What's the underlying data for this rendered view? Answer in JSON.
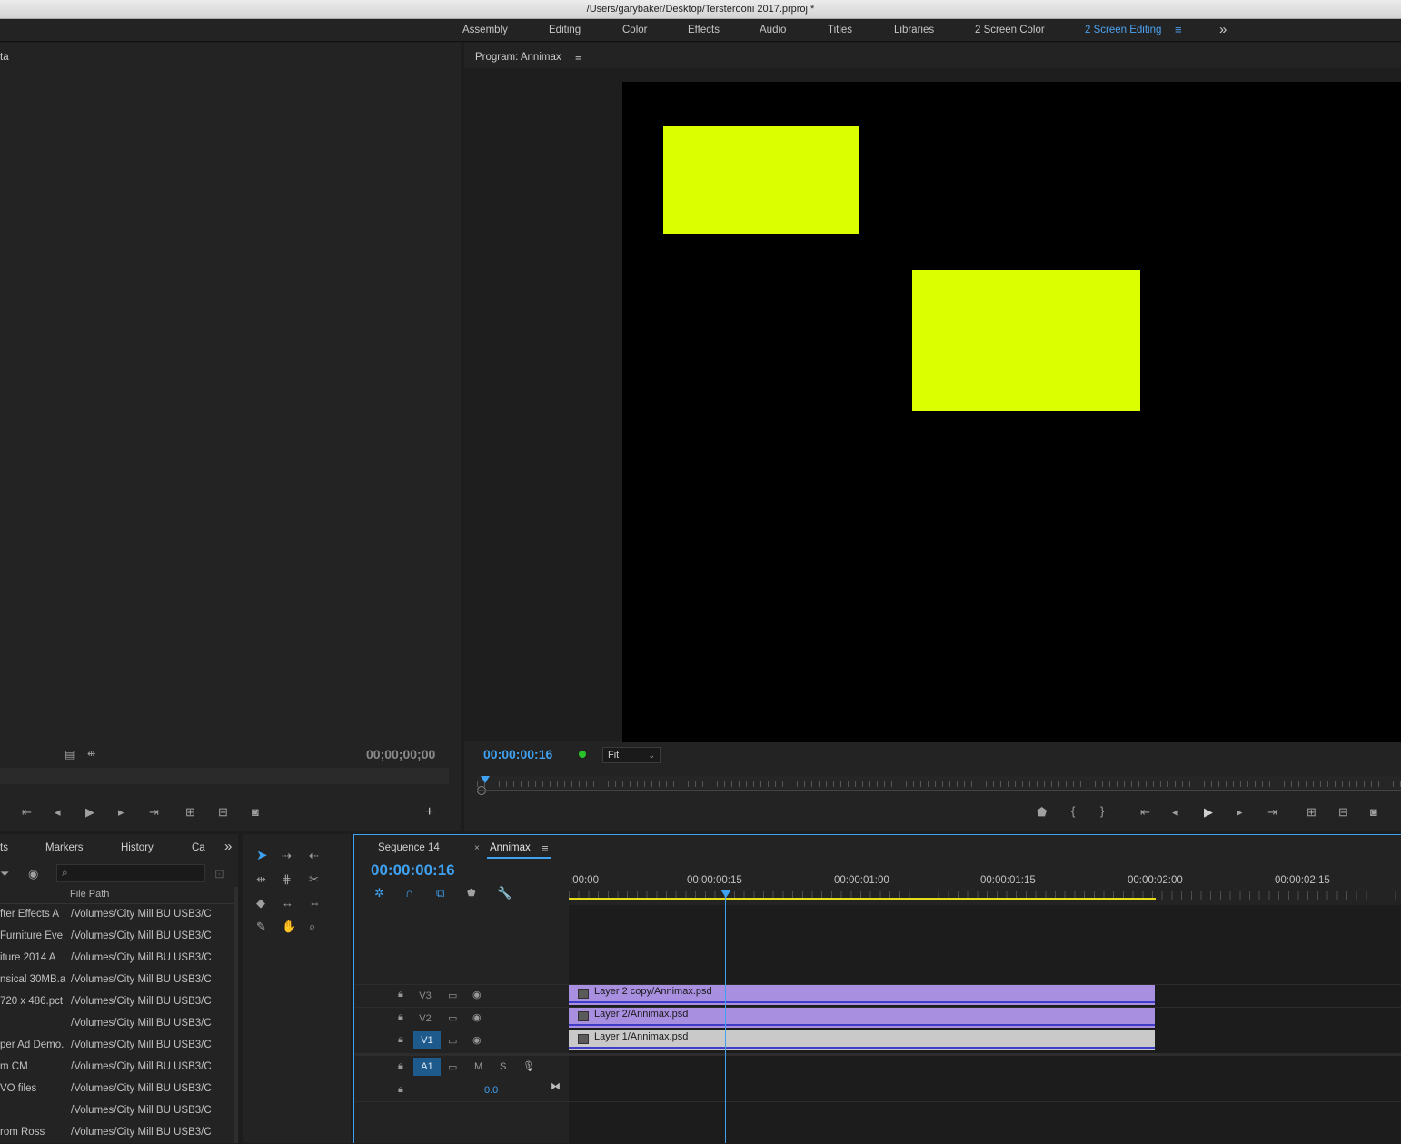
{
  "window": {
    "title": "/Users/garybaker/Desktop/Tersterooni 2017.prproj *"
  },
  "workspaces": {
    "tabs": [
      "Assembly",
      "Editing",
      "Color",
      "Effects",
      "Audio",
      "Titles",
      "Libraries",
      "2 Screen Color",
      "2 Screen Editing"
    ],
    "active": "2 Screen Editing",
    "overflow_icon": "double-chevron-right-icon"
  },
  "source_monitor": {
    "title_fragment": "ta",
    "timecode": "00;00;00;00"
  },
  "program_monitor": {
    "title": "Program: Annimax",
    "timecode": "00:00:00:16",
    "zoom": "Fit",
    "playhead_fraction": 0.005,
    "frame_bg": "#000000",
    "shape_color": "#dcff00"
  },
  "project_panel": {
    "tabs": [
      "ts",
      "Markers",
      "History",
      "Ca"
    ],
    "search_placeholder": "",
    "column_header": "File Path",
    "rows": [
      {
        "name": "fter Effects A",
        "path": "/Volumes/City Mill BU USB3/C"
      },
      {
        "name": " Furniture Eve",
        "path": "/Volumes/City Mill BU USB3/C"
      },
      {
        "name": "iture 2014 A",
        "path": "/Volumes/City Mill BU USB3/C"
      },
      {
        "name": "nsical 30MB.a",
        "path": "/Volumes/City Mill BU USB3/C"
      },
      {
        "name": "720 x 486.pct",
        "path": "/Volumes/City Mill BU USB3/C"
      },
      {
        "name": "",
        "path": "/Volumes/City Mill BU USB3/C"
      },
      {
        "name": "per Ad Demo.",
        "path": "/Volumes/City Mill BU USB3/C"
      },
      {
        "name": "m CM",
        "path": "/Volumes/City Mill BU USB3/C"
      },
      {
        "name": "VO files",
        "path": "/Volumes/City Mill BU USB3/C"
      },
      {
        "name": "",
        "path": "/Volumes/City Mill BU USB3/C"
      },
      {
        "name": "rom Ross",
        "path": "/Volumes/City Mill BU USB3/C"
      }
    ]
  },
  "timeline": {
    "tabs": [
      "Sequence 14",
      "Annimax"
    ],
    "active_tab": "Annimax",
    "timecode": "00:00:00:16",
    "ruler_labels": [
      ":00:00",
      "00:00:00:15",
      "00:00:01:00",
      "00:00:01:15",
      "00:00:02:00",
      "00:00:02:15"
    ],
    "tracks": {
      "v3": "V3",
      "v2": "V2",
      "v1": "V1",
      "a1": "A1",
      "a1_mute": "M",
      "a1_solo": "S",
      "master_volume": "0.0"
    },
    "clips": [
      {
        "track": "V3",
        "label": "Layer 2 copy/Annimax.psd",
        "color": "#a98fe0"
      },
      {
        "track": "V2",
        "label": "Layer 2/Annimax.psd",
        "color": "#a98fe0"
      },
      {
        "track": "V1",
        "label": "Layer 1/Annimax.psd",
        "color": "#c9c9c9"
      }
    ]
  },
  "colors": {
    "accent_blue": "#3fa1f2",
    "work_area": "#e4dc1a"
  }
}
